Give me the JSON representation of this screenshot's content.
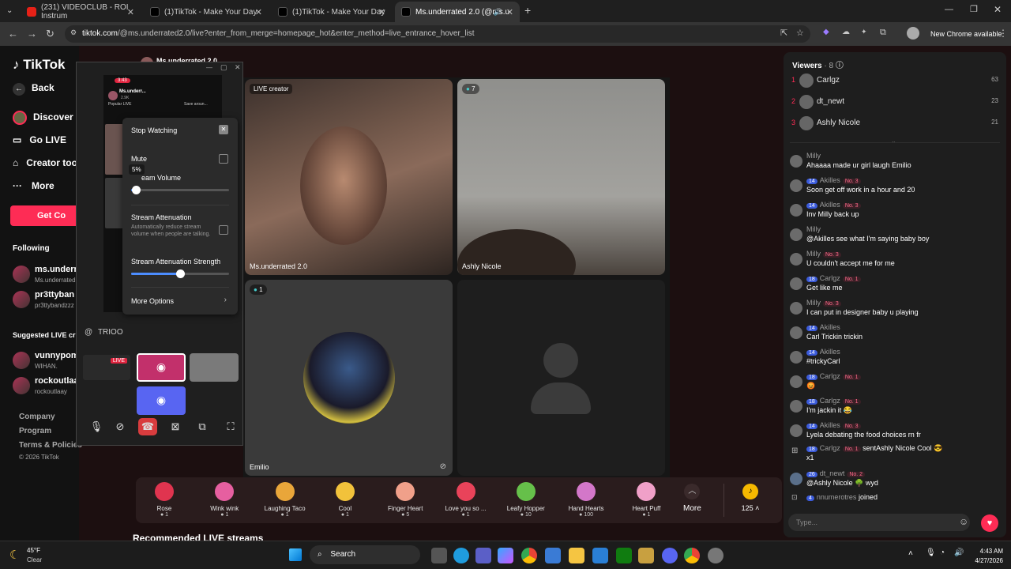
{
  "browser": {
    "tabs": [
      {
        "title": "(231) VIDEOCLUB - ROI Instrum"
      },
      {
        "title": "(1)TikTok - Make Your Day"
      },
      {
        "title": "(1)TikTok - Make Your Day"
      },
      {
        "title": "Ms.underrated 2.0 (@ms.u"
      }
    ],
    "url_host": "tiktok.com",
    "url_path": "/@ms.underrated2.0/live?enter_from_merge=homepage_hot&enter_method=live_entrance_hover_list",
    "chrome_notice": "New Chrome available"
  },
  "tiktok": {
    "logo": "TikTok",
    "back": "Back",
    "nav": [
      "Discover L",
      "Go LIVE",
      "Creator too",
      "More"
    ],
    "get_coins": "Get Co",
    "following_title": "Following",
    "following": [
      {
        "name": "ms.underr",
        "sub": "Ms.underrated"
      },
      {
        "name": "pr3ttyban",
        "sub": "pr3ttybandzzz"
      }
    ],
    "suggested_title": "Suggested LIVE cr",
    "suggested": [
      {
        "name": "vunnypom",
        "sub": "WIHAN."
      },
      {
        "name": "rockoutlaa",
        "sub": "rockoutlaay"
      }
    ],
    "footer": [
      "Company",
      "Program",
      "Terms & Policies",
      "© 2026 TikTok"
    ],
    "header_name": "Ms.underrated 2.0",
    "recommended": "Recommended LIVE streams"
  },
  "stage": {
    "live_creator": "LIVE creator",
    "host_label": "Ms.underrated 2.0",
    "guest1_count": "7",
    "guest1_label": "Ashly Nicole",
    "guest2_count": "1",
    "guest2_label": "Emilio"
  },
  "gifts": [
    {
      "name": "Rose",
      "cost": "1",
      "color": "#e0344f"
    },
    {
      "name": "Wink wink",
      "cost": "1",
      "color": "#e65fa0"
    },
    {
      "name": "Laughing Taco",
      "cost": "1",
      "color": "#e9a63a"
    },
    {
      "name": "Cool",
      "cost": "1",
      "color": "#f2c23b"
    },
    {
      "name": "Finger Heart",
      "cost": "5",
      "color": "#f0a08a"
    },
    {
      "name": "Love you so ...",
      "cost": "1",
      "color": "#e9435a"
    },
    {
      "name": "Leafy Hopper",
      "cost": "10",
      "color": "#66c04a"
    },
    {
      "name": "Hand Hearts",
      "cost": "100",
      "color": "#d377c9"
    },
    {
      "name": "Heart Puff",
      "cost": "1",
      "color": "#f0a0c8"
    }
  ],
  "gift_more": "More",
  "coin_balance": "125",
  "viewers": {
    "title": "Viewers",
    "count": "· 8",
    "top": [
      {
        "rank": "1",
        "name": "Carlgz",
        "score": "63"
      },
      {
        "rank": "2",
        "name": "dt_newt",
        "score": "23"
      },
      {
        "rank": "3",
        "name": "Ashly Nicole",
        "score": "21"
      }
    ]
  },
  "chat": [
    {
      "user": "Milly",
      "lv": "",
      "no": "",
      "text": "Ahaaaa made ur girl laugh Emilio"
    },
    {
      "user": "Akilles",
      "lv": "14",
      "no": "No. 3",
      "text": "Soon get off work in a hour and 20"
    },
    {
      "user": "Akilles",
      "lv": "14",
      "no": "No. 3",
      "text": "Inv Milly back up"
    },
    {
      "user": "Milly",
      "lv": "",
      "no": "",
      "text": "@Akilles see what I'm saying baby boy"
    },
    {
      "user": "Milly",
      "lv": "",
      "no": "No. 3",
      "text": "U couldn't accept me for me"
    },
    {
      "user": "Carlgz",
      "lv": "18",
      "no": "No. 1",
      "text": "Get like me"
    },
    {
      "user": "Milly",
      "lv": "",
      "no": "No. 3",
      "text": "I can put in designer baby u playing"
    },
    {
      "user": "Akilles",
      "lv": "14",
      "no": "",
      "text": "Carl Trickin trickin"
    },
    {
      "user": "Akilles",
      "lv": "14",
      "no": "",
      "text": "#trickyCarl"
    },
    {
      "user": "Carlgz",
      "lv": "18",
      "no": "No. 1",
      "text": "😡"
    },
    {
      "user": "Carlgz",
      "lv": "18",
      "no": "No. 1",
      "text": "I'm jackin it 😂"
    },
    {
      "user": "Akilles",
      "lv": "14",
      "no": "No. 3",
      "text": "Lyela debating the food choices rn fr"
    }
  ],
  "gift_line": {
    "user": "Carlgz",
    "lv": "18",
    "no": "No. 1",
    "action": "sent",
    "target": "Ashly Nicole",
    "gift": "Cool",
    "qty": "x1"
  },
  "last_msgs": [
    {
      "user": "dt_newt",
      "lv": "26",
      "no": "No. 2",
      "text": "@Ashly Nicole 🌳 wyd"
    },
    {
      "user": "nnumerotres",
      "lv": "4",
      "no": "",
      "text": "joined"
    }
  ],
  "chat_input_placeholder": "Type...",
  "popup": {
    "phone_time": "3:43",
    "phone_name": "Ms.underr...",
    "phone_followers": "2.9K",
    "popular": "Popular LIVE",
    "save": "Save aroun...",
    "menu": {
      "stop": "Stop Watching",
      "mute": "Mute",
      "volume_pct": "5%",
      "volume_label": "eam Volume",
      "attenuation": "Stream Attenuation",
      "attenuation_desc": "Automatically reduce stream volume when people are talking.",
      "strength": "Stream Attenuation Strength",
      "more": "More Options"
    },
    "volume": 0.05,
    "strength": 0.5,
    "channel": "TRIOO",
    "live_tag": "LIVE"
  },
  "taskbar": {
    "weather_temp": "45°F",
    "weather_desc": "Clear",
    "search": "Search",
    "time": "4:43 AM",
    "date": "4/27/2026"
  }
}
